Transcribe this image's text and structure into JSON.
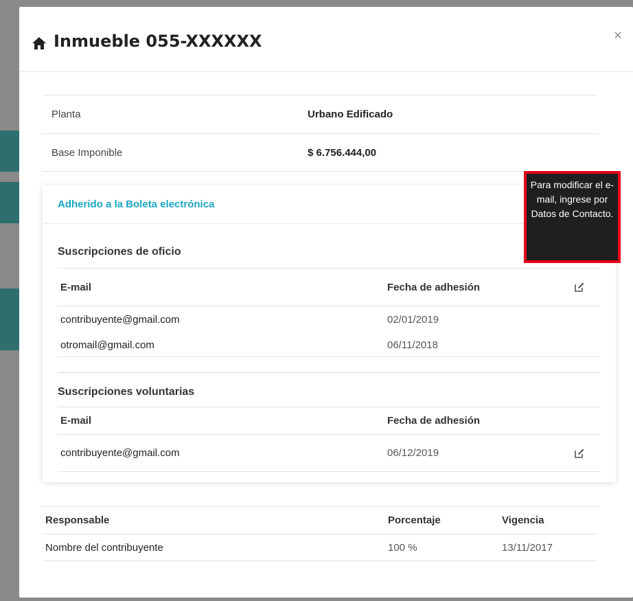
{
  "modal": {
    "title": "Inmueble 055-XXXXXX",
    "close_label": "×"
  },
  "info": [
    {
      "label": "Planta",
      "value": "Urbano Edificado"
    },
    {
      "label": "Base Imponible",
      "value": "$ 6.756.444,00"
    }
  ],
  "panel": {
    "heading": "Adherido a la Boleta electrónica",
    "oficio": {
      "title": "Suscripciones de oficio",
      "col_email": "E-mail",
      "col_date": "Fecha de adhesión",
      "rows": [
        {
          "email": "contribuyente@gmail.com",
          "date": "02/01/2019"
        },
        {
          "email": "otromail@gmail.com",
          "date": "06/11/2018"
        }
      ]
    },
    "voluntarias": {
      "title": "Suscripciones voluntarias",
      "col_email": "E-mail",
      "col_date": "Fecha de adhesión",
      "rows": [
        {
          "email": "contribuyente@gmail.com",
          "date": "06/12/2019"
        }
      ]
    }
  },
  "responsables": {
    "col_responsable": "Responsable",
    "col_porcentaje": "Porcentaje",
    "col_vigencia": "Vigencia",
    "rows": [
      {
        "nombre": "Nombre del contribuyente",
        "porcentaje": "100 %",
        "vigencia": "13/11/2017"
      }
    ]
  },
  "tooltip": {
    "text": "Para modificar el e-mail, ingrese por Datos de Contacto."
  },
  "colors": {
    "accent": "#1ba6c3",
    "highlight": "#e8001c",
    "tooltip_bg": "#1f1f1f"
  },
  "icons": [
    "home-icon",
    "close-icon",
    "edit-icon",
    "chevron-down-icon"
  ]
}
